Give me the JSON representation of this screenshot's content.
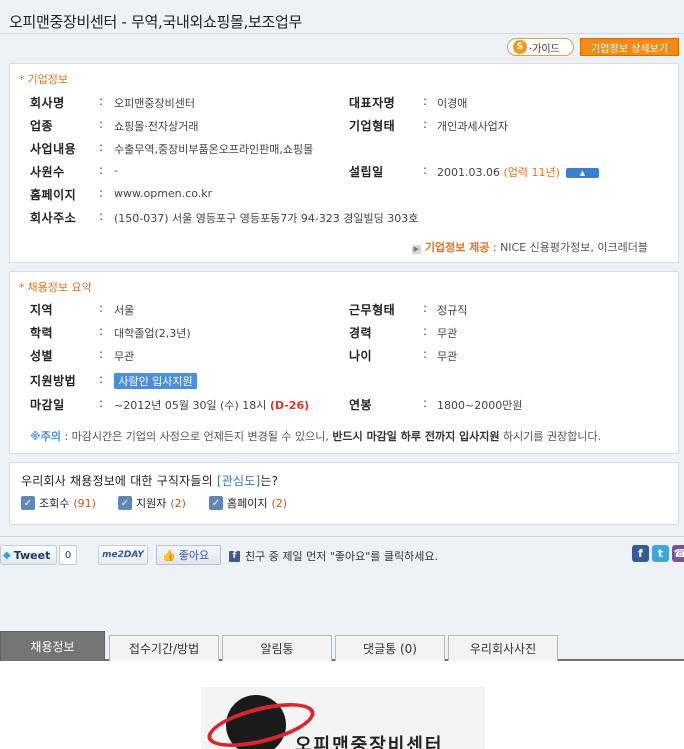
{
  "page_title": "오피맨중장비센터 - 무역,국내외쇼핑몰,보조업무",
  "header_buttons": {
    "guide": "가이드",
    "guide_letter": "S",
    "company_detail": "기업정보 상세보기"
  },
  "company": {
    "section_title": "기업정보",
    "rows": {
      "name": {
        "label": "회사명",
        "value": "오피맨중장비센터"
      },
      "ceo": {
        "label": "대표자명",
        "value": "이경애"
      },
      "industry": {
        "label": "업종",
        "value": "쇼핑몰·전자상거래"
      },
      "type": {
        "label": "기업형태",
        "value": "개인과세사업자"
      },
      "business": {
        "label": "사업내용",
        "value": "수출무역,중장비부품온오프라인판매,쇼핑몰"
      },
      "employees": {
        "label": "사원수",
        "value": "-"
      },
      "founded": {
        "label": "설립일",
        "value": "2001.03.06",
        "sub": "(업력 11년)"
      },
      "homepage": {
        "label": "홈페이지",
        "value": "www.opmen.co.kr"
      },
      "address": {
        "label": "회사주소",
        "value": "(150-037) 서울 영등포구 영등포동7가 94-323 경일빌딩 303호"
      }
    },
    "source_label": "기업정보 제공",
    "source_value": ": NICE 신용평가정보, 이크레더블"
  },
  "recruit": {
    "section_title": "채용정보 요약",
    "rows": {
      "region": {
        "label": "지역",
        "value": "서울"
      },
      "work_type": {
        "label": "근무형태",
        "value": "정규직"
      },
      "education": {
        "label": "학력",
        "value": "대학졸업(2,3년)"
      },
      "career": {
        "label": "경력",
        "value": "무관"
      },
      "gender": {
        "label": "성별",
        "value": "무관"
      },
      "age": {
        "label": "나이",
        "value": "무관"
      },
      "apply_method": {
        "label": "지원방법",
        "button": "사람인 입사지원"
      },
      "deadline": {
        "label": "마감일",
        "value": "~2012년 05월 30일 (수) 18시",
        "dday": "(D-26)"
      },
      "salary": {
        "label": "연봉",
        "value": "1800~2000만원"
      }
    },
    "note_mark": "※주의",
    "note_text": ": 마감시간은 기업의 사정으로 언제든지 변경될 수 있으니,",
    "note_bold": "반드시 마감일 하루 전까지 입사지원",
    "note_tail": "하시기를 권장합니다."
  },
  "interest": {
    "question_pre": "우리회사 채용정보에 대한 구직자들의",
    "question_hl": "[관심도]",
    "question_post": "는?",
    "items": [
      {
        "label": "조회수",
        "count": "(91)"
      },
      {
        "label": "지원자",
        "count": "(2)"
      },
      {
        "label": "홈페이지",
        "count": "(2)"
      }
    ]
  },
  "social": {
    "tweet_label": "Tweet",
    "tweet_count": "0",
    "me2day_label": "me2DAY",
    "like_label": "좋아요",
    "fb_prompt": "친구 중 제일 먼저 \"좋아요\"를 클릭하세요."
  },
  "tabs": [
    "채용정보",
    "접수기간/방법",
    "알림통",
    "댓글통 (0)",
    "우리회사사진"
  ],
  "logo_text": "오피맨중장비센터"
}
